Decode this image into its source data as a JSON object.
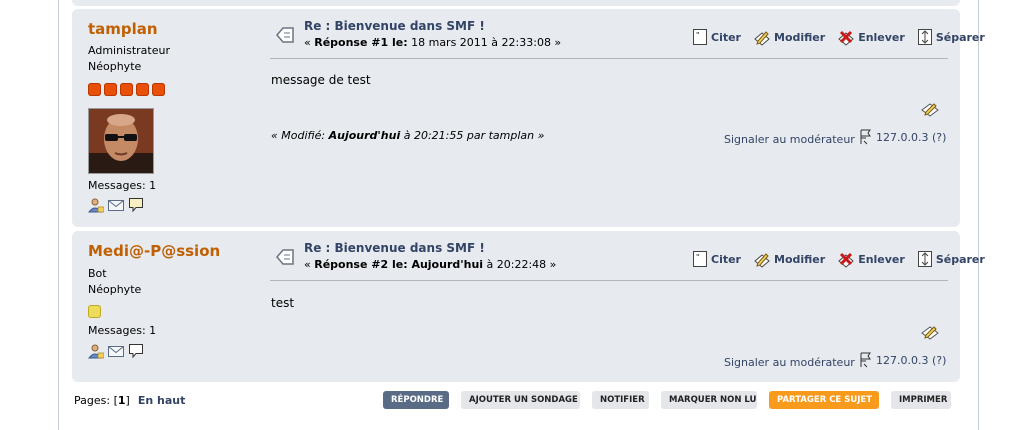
{
  "posts": [
    {
      "poster": {
        "name": "tamplan",
        "group": "Administrateur",
        "post_group": "Néophyte",
        "messages": "Messages: 1"
      },
      "subject": "Re : Bienvenue dans SMF !",
      "reply_prefix": "« ",
      "reply_label": "Réponse #1 le:",
      "reply_date": " 18 mars 2011 à 22:33:08 »",
      "reply_date_bold": "",
      "body": "message de test",
      "modified": {
        "prefix": "« Modifié: ",
        "date_bold": "Aujourd'hui",
        "suffix": " à 20:21:55 par tamplan »"
      },
      "report": "Signaler au modérateur",
      "ip": "127.0.0.3 (?)"
    },
    {
      "poster": {
        "name": "Medi@-P@ssion",
        "group": "Bot",
        "post_group": "Néophyte",
        "messages": "Messages: 1"
      },
      "subject": "Re : Bienvenue dans SMF !",
      "reply_prefix": "« ",
      "reply_label": "Réponse #2 le:",
      "reply_date_bold": " Aujourd'hui",
      "reply_date": " à 20:22:48 »",
      "body": "test",
      "report": "Signaler au modérateur",
      "ip": "127.0.0.3 (?)"
    }
  ],
  "actions": {
    "quote": "Citer",
    "modify": "Modifier",
    "remove": "Enlever",
    "split": "Séparer"
  },
  "footer": {
    "pages_label": "Pages: [",
    "current_page": "1",
    "pages_close": "]",
    "top_link": "En haut",
    "buttons": {
      "reply": "RÉPONDRE",
      "add_poll": "AJOUTER UN SONDAGE",
      "notify": "NOTIFIER",
      "mark_unread": "MARQUER NON LU",
      "share": "PARTAGER CE SUJET",
      "print": "IMPRIMER"
    }
  },
  "icons": {
    "subject": "message-doc-icon",
    "quote": "quote-icon",
    "modify": "edit-icon",
    "remove": "delete-icon",
    "split": "split-icon",
    "quick_quote": "quick-quote-icon",
    "ip": "ip-icon",
    "profile": "profile-icon",
    "email": "email-icon",
    "pm": "pm-icon"
  },
  "colors": {
    "poster_name": "#c06002",
    "link": "#334466",
    "post_bg": "#e7eaef",
    "star_orange": "#e8500a",
    "star_yellow": "#ecdc5a",
    "button_active": "#5a6c85",
    "button_share": "#f89b1c"
  },
  "poster_stars": [
    5,
    1
  ]
}
